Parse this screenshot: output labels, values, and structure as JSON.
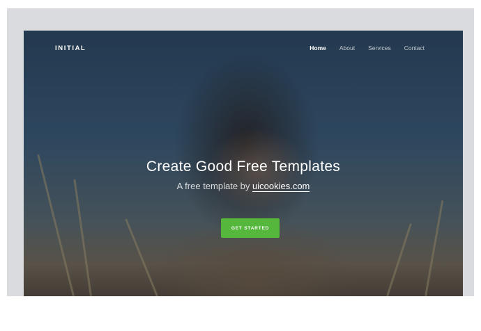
{
  "nav": {
    "brand": "INITIAL",
    "items": [
      {
        "label": "Home",
        "active": true
      },
      {
        "label": "About",
        "active": false
      },
      {
        "label": "Services",
        "active": false
      },
      {
        "label": "Contact",
        "active": false
      }
    ]
  },
  "hero": {
    "title": "Create Good Free Templates",
    "subtitle_prefix": "A free template by",
    "subtitle_link": "uicookies.com",
    "cta_label": "GET STARTED"
  },
  "colors": {
    "accent": "#55b83c",
    "frame": "#d9dbdf"
  }
}
